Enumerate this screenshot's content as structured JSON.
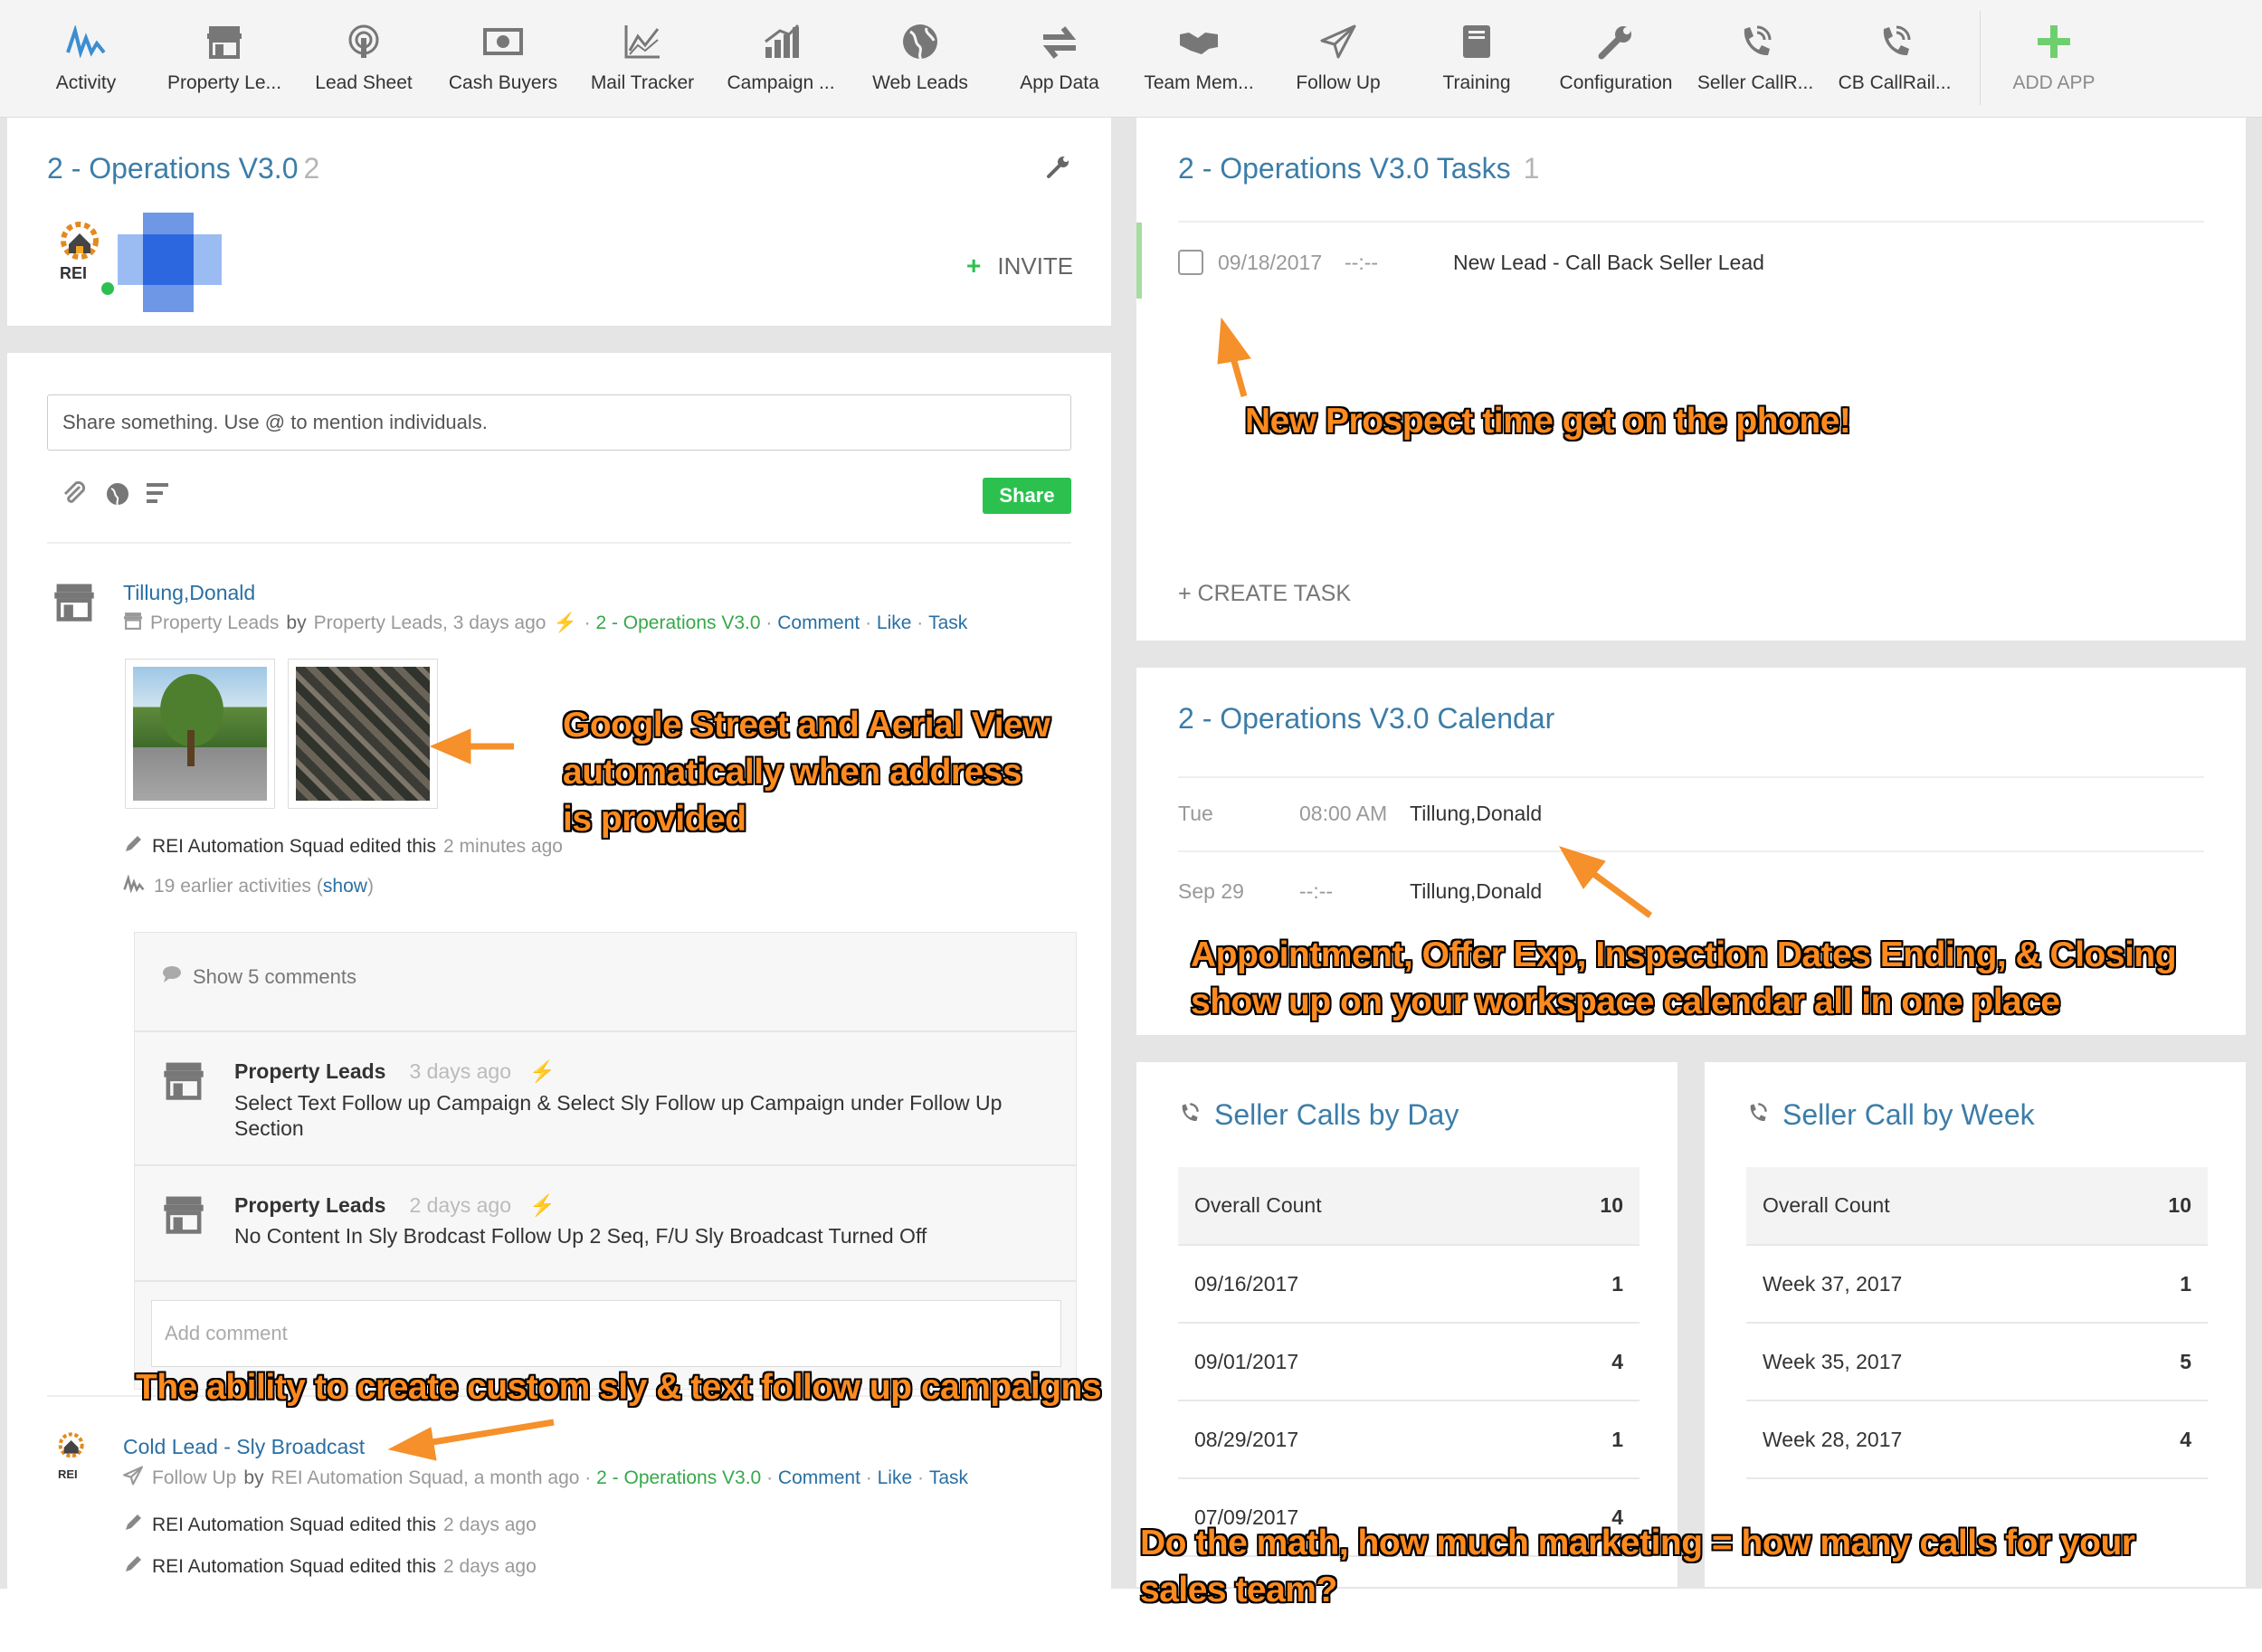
{
  "topbar": {
    "apps": [
      {
        "label": "Activity",
        "icon": "activity-icon"
      },
      {
        "label": "Property Le...",
        "icon": "store-icon"
      },
      {
        "label": "Lead Sheet",
        "icon": "podcast-icon"
      },
      {
        "label": "Cash Buyers",
        "icon": "cash-icon"
      },
      {
        "label": "Mail Tracker",
        "icon": "chart-icon"
      },
      {
        "label": "Campaign ...",
        "icon": "bar-chart-icon"
      },
      {
        "label": "Web Leads",
        "icon": "globe-icon"
      },
      {
        "label": "App Data",
        "icon": "exchange-icon"
      },
      {
        "label": "Team Mem...",
        "icon": "handshake-icon"
      },
      {
        "label": "Follow Up",
        "icon": "paper-plane-icon"
      },
      {
        "label": "Training",
        "icon": "book-icon"
      },
      {
        "label": "Configuration",
        "icon": "wrench-icon"
      },
      {
        "label": "Seller CallR...",
        "icon": "phone-icon"
      },
      {
        "label": "CB CallRail...",
        "icon": "phone-icon"
      }
    ],
    "add_app": "ADD APP"
  },
  "workspace": {
    "title": "2 - Operations V3.0",
    "count": "2",
    "logo_text": "REI",
    "invite": "INVITE"
  },
  "stream": {
    "share_placeholder": "Share something. Use @ to mention individuals.",
    "share_button": "Share",
    "item1": {
      "title": "Tillung,Donald",
      "app": "Property Leads",
      "by": "by",
      "author": "Property Leads, 3 days ago",
      "workspace": "2 - Operations V3.0",
      "comment": "Comment",
      "like": "Like",
      "task": "Task",
      "edited_by": "REI Automation Squad edited this",
      "edited_when": "2 minutes ago",
      "earlier": "19 earlier activities",
      "show": "show",
      "show_comments": "Show 5 comments",
      "comments": [
        {
          "author": "Property Leads",
          "time": "3 days ago",
          "text": "Select Text Follow up Campaign & Select Sly Follow up Campaign under Follow Up Section"
        },
        {
          "author": "Property Leads",
          "time": "2 days ago",
          "text": "No Content In Sly Brodcast Follow Up 2 Seq, F/U Sly Broadcast Turned Off"
        }
      ],
      "add_comment": "Add comment"
    },
    "item2": {
      "title": "Cold Lead - Sly Broadcast",
      "app": "Follow Up",
      "by": "by",
      "author": "REI Automation Squad, a month ago",
      "workspace": "2 - Operations V3.0",
      "comment": "Comment",
      "like": "Like",
      "task": "Task",
      "edits": [
        {
          "by": "REI Automation Squad edited this",
          "when": "2 days ago"
        },
        {
          "by": "REI Automation Squad edited this",
          "when": "2 days ago"
        }
      ]
    }
  },
  "tasks": {
    "title": "2 - Operations V3.0 Tasks",
    "count": "1",
    "task": {
      "date": "09/18/2017",
      "time": "--:--",
      "text": "New Lead - Call Back Seller Lead"
    },
    "create": "+ CREATE TASK"
  },
  "calendar": {
    "title": "2 - Operations V3.0 Calendar",
    "events": [
      {
        "day": "Tue",
        "time": "08:00 AM",
        "name": "Tillung,Donald"
      },
      {
        "day": "Sep 29",
        "time": "--:--",
        "name": "Tillung,Donald"
      }
    ]
  },
  "calls_day": {
    "title": "Seller Calls by Day",
    "rows": [
      {
        "label": "Overall Count",
        "value": "10"
      },
      {
        "label": "09/16/2017",
        "value": "1"
      },
      {
        "label": "09/01/2017",
        "value": "4"
      },
      {
        "label": "08/29/2017",
        "value": "1"
      },
      {
        "label": "07/09/2017",
        "value": "4"
      }
    ]
  },
  "calls_week": {
    "title": "Seller Call by Week",
    "rows": [
      {
        "label": "Overall Count",
        "value": "10"
      },
      {
        "label": "Week 37, 2017",
        "value": "1"
      },
      {
        "label": "Week 35, 2017",
        "value": "5"
      },
      {
        "label": "Week 28, 2017",
        "value": "4"
      }
    ]
  },
  "annotations": {
    "phone": "New Prospect time get on the phone!",
    "street": [
      "Google Street and Aerial View",
      "automatically when address",
      "is provided"
    ],
    "calendar": [
      "Appointment, Offer Exp, Inspection Dates Ending, & Closing",
      "show up on your workspace calendar all in one place"
    ],
    "campaigns": "The ability to create custom sly & text follow up campaigns",
    "math": [
      "Do the math, how much marketing = how many calls for your",
      "sales team?"
    ]
  },
  "colors": {
    "accent": "#3c7da8",
    "green": "#2cc14f",
    "annotation": "#ff8a1e",
    "arrow": "#f5902a"
  }
}
